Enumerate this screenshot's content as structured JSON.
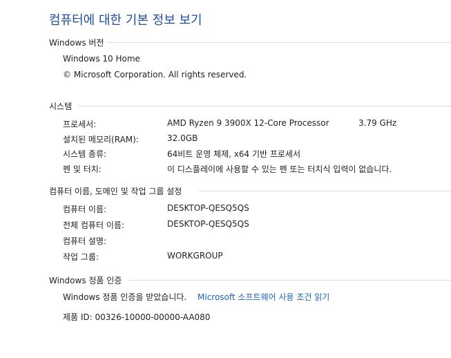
{
  "page_title": "컴퓨터에 대한 기본 정보 보기",
  "windows_edition": {
    "header": "Windows 버전",
    "edition": "Windows 10 Home",
    "copyright": "© Microsoft Corporation. All rights reserved."
  },
  "system": {
    "header": "시스템",
    "processor_label": "프로세서:",
    "processor_value": "AMD Ryzen 9 3900X 12-Core Processor",
    "processor_speed": "3.79 GHz",
    "ram_label": "설치된 메모리(RAM):",
    "ram_value": "32.0GB",
    "type_label": "시스템 종류:",
    "type_value": "64비트 운영 체제, x64 기반 프로세서",
    "pen_label": "펜 및 터치:",
    "pen_value": "이 디스플레이에 사용할 수 있는 펜 또는 터치식 입력이 없습니다."
  },
  "computer_name": {
    "header": "컴퓨터 이름, 도메인 및 작업 그룹 설정",
    "name_label": "컴퓨터 이름:",
    "name_value": "DESKTOP-QESQ5QS",
    "full_name_label": "전체 컴퓨터 이름:",
    "full_name_value": "DESKTOP-QESQ5QS",
    "description_label": "컴퓨터 설명:",
    "description_value": "",
    "workgroup_label": "작업 그룹:",
    "workgroup_value": "WORKGROUP"
  },
  "activation": {
    "header": "Windows 정품 인증",
    "status": "Windows 정품 인증을 받았습니다.",
    "terms_link": "Microsoft 소프트웨어 사용 조건 읽기",
    "product_id": "제품 ID: 00326-10000-00000-AA080"
  }
}
